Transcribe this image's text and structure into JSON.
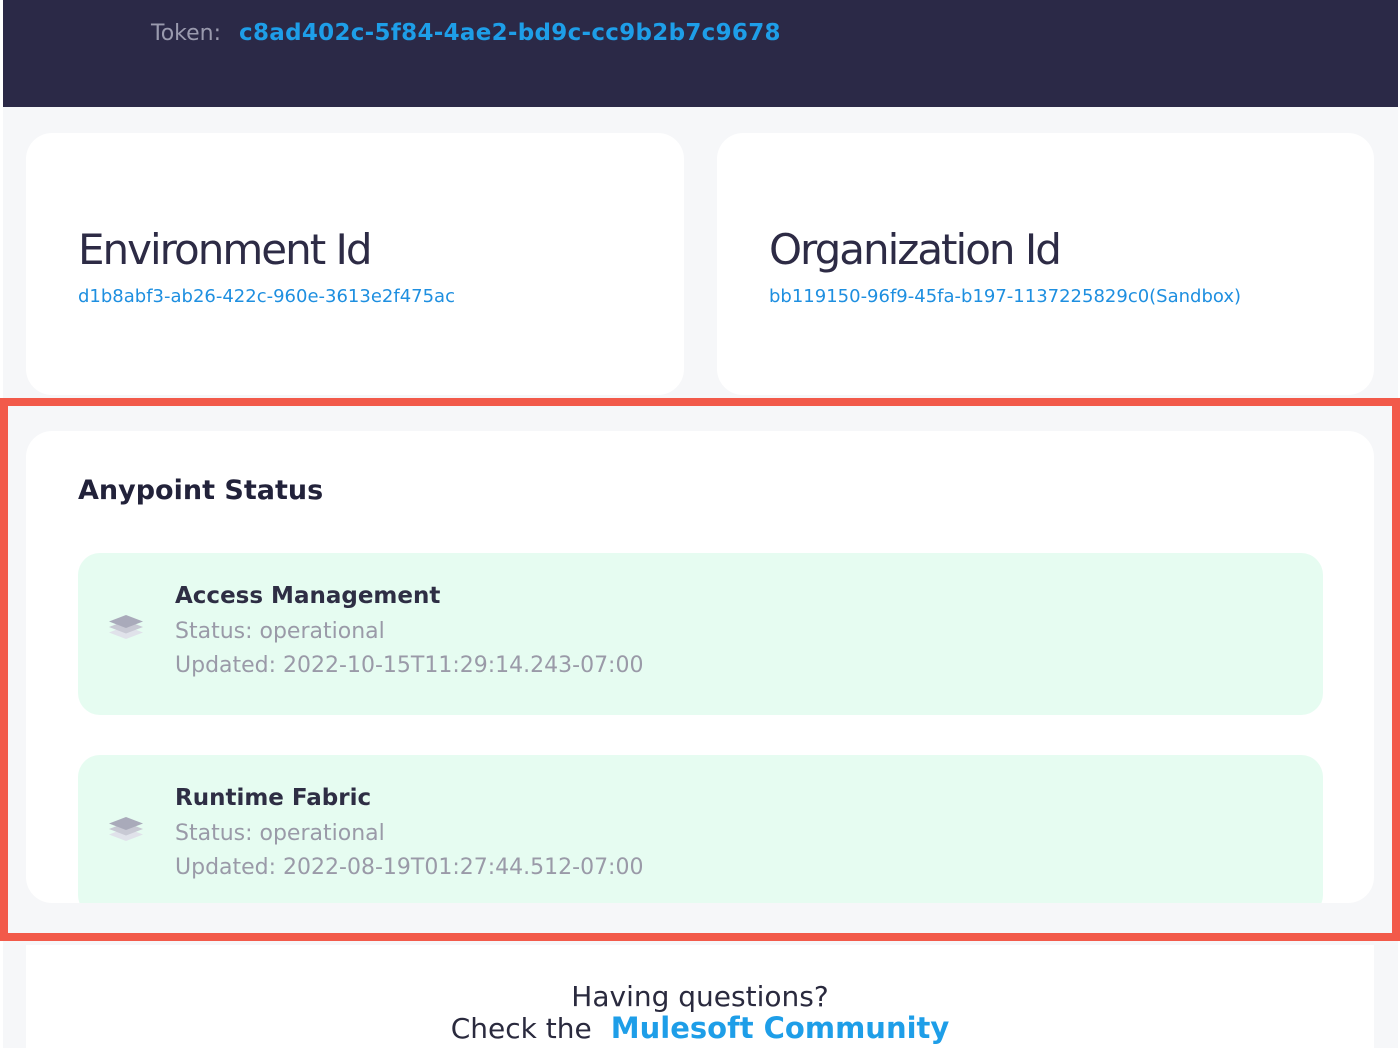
{
  "header": {
    "token_label": "Token:",
    "token_value": "c8ad402c-5f84-4ae2-bd9c-cc9b2b7c9678"
  },
  "environment": {
    "title": "Environment Id",
    "value": "d1b8abf3-ab26-422c-960e-3613e2f475ac"
  },
  "organization": {
    "title": "Organization Id",
    "value": "bb119150-96f9-45fa-b197-1137225829c0(Sandbox)"
  },
  "status": {
    "title": "Anypoint Status",
    "items": [
      {
        "name": "Access Management",
        "status": "Status: operational",
        "updated": "Updated: 2022-10-15T11:29:14.243-07:00"
      },
      {
        "name": "Runtime Fabric",
        "status": "Status: operational",
        "updated": "Updated: 2022-08-19T01:27:44.512-07:00"
      }
    ]
  },
  "footer": {
    "question": "Having questions?",
    "check_text": "Check the",
    "link_text": "Mulesoft Community"
  },
  "colors": {
    "header_bg": "#2b2947",
    "accent": "#1e9ee8",
    "status_item_bg": "#e6fcf1",
    "highlight_border": "#f25a4a"
  },
  "icons": {
    "status_item_icon": "layers-icon"
  }
}
